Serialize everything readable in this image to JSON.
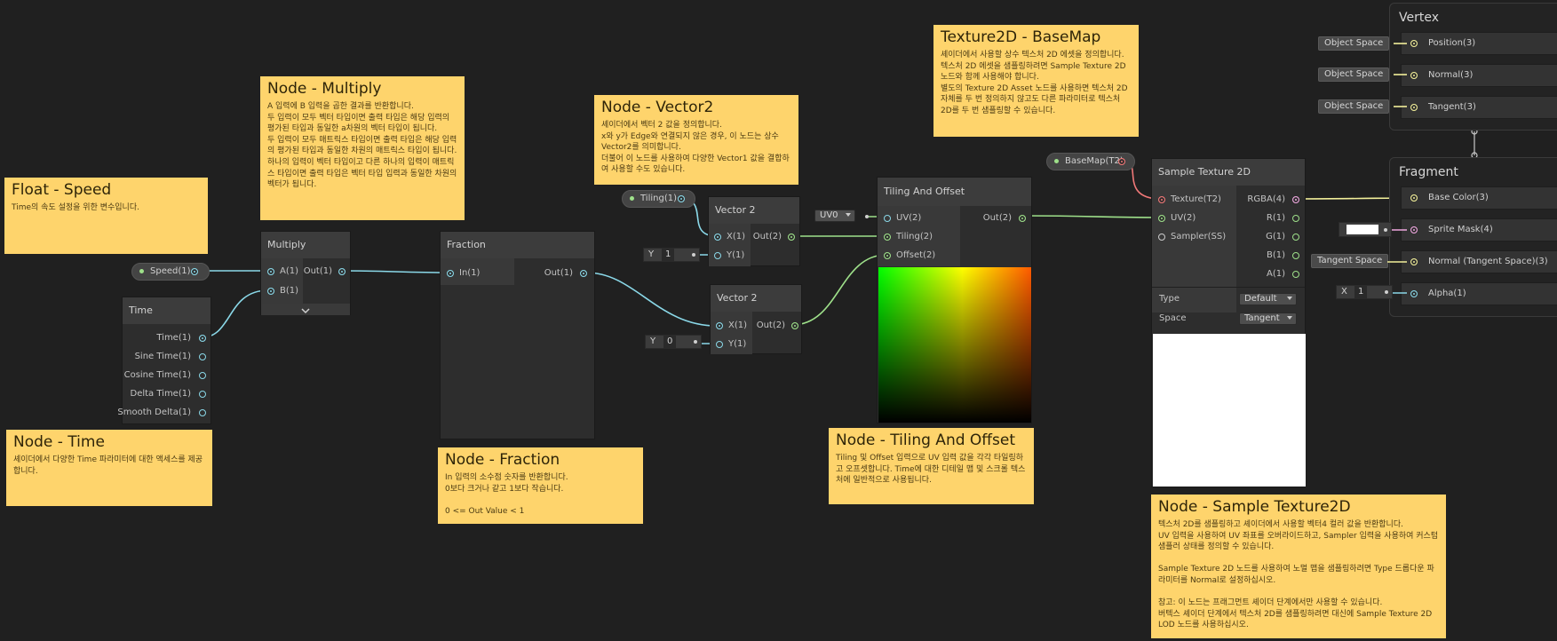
{
  "notes": {
    "float_speed": {
      "title": "Float - Speed",
      "body": "Time의 속도 설정을 위한 변수입니다."
    },
    "multiply": {
      "title": "Node - Multiply",
      "body": "A 입력에 B 입력을 곱한 결과를 반환합니다.\n두 입력이 모두 벡터 타입이면 출력 타입은 해당 입력의 평가된 타입과 동일한 a차원의 벡터 타입이 됩니다.\n두 입력이 모두 매트릭스 타입이면 출력 타입은 해당 입력의 평가된 타입과 동일한 차원의 매트릭스 타입이 됩니다.\n하나의 입력이 벡터 타입이고 다른 하나의 입력이 매트릭스 타입이면 출력 타입은 벡터 타입 입력과 동일한 차원의 벡터가 됩니다."
    },
    "time": {
      "title": "Node - Time",
      "body": "셰이더에서 다양한 Time 파라미터에 대한 액세스를 제공합니다."
    },
    "fraction": {
      "title": "Node - Fraction",
      "body": "In 입력의 소수점 숫자를 반환합니다.\n0보다 크거나 같고 1보다 작습니다.\n\n0 <= Out Value < 1"
    },
    "vector2": {
      "title": "Node - Vector2",
      "body": "셰이더에서 벡터 2 값을 정의합니다.\nx와 y가 Edge와 연결되지 않은 경우, 이 노드는 상수 Vector2를 의미합니다.\n더불어 이 노드를 사용하여 다양한 Vector1 값을 결합하여 사용할 수도 있습니다."
    },
    "texture2d": {
      "title": "Texture2D - BaseMap",
      "body": "셰이더에서 사용할 상수 텍스처 2D 에셋을 정의합니다.\n텍스처 2D 에셋을 샘플링하려면 Sample Texture 2D 노드와 함께 사용해야 합니다.\n별도의 Texture 2D Asset 노드를 사용하면 텍스처 2D 자체를 두 번 정의하지 않고도 다른 파라미터로 텍스처 2D를 두 번 샘플링할 수 있습니다."
    },
    "tiling": {
      "title": "Node - Tiling And Offset",
      "body": "Tiling 및 Offset 입력으로 UV 입력 값을 각각 타일링하고 오프셋합니다. Time에 대한 디테일 맵 및 스크롤 텍스처에 일반적으로 사용됩니다."
    },
    "sample": {
      "title": "Node - Sample Texture2D",
      "body": "텍스처 2D를 샘플링하고 셰이더에서 사용할 벡터4 컬러 값을 반환합니다.\nUV 입력을 사용하여 UV 좌표를 오버라이드하고, Sampler 입력을 사용하여 커스텀 샘플러 상태를 정의할 수 있습니다.\n\nSample Texture 2D 노드를 사용하여 노멀 맵을 샘플링하려면 Type 드롭다운 파라미터를 Normal로 설정하십시오.\n\n참고: 이 노드는 프래그먼트 셰이더 단계에서만 사용할 수 있습니다.\n버텍스 셰이더 단계에서 텍스처 2D를 샘플링하려면 대신에 Sample Texture 2D LOD 노드를 사용하십시오."
    }
  },
  "properties": {
    "speed": "Speed(1)",
    "tiling": "Tiling(1)",
    "basemap": "BaseMap(T2)"
  },
  "nodes": {
    "time": {
      "title": "Time",
      "outputs": [
        "Time(1)",
        "Sine Time(1)",
        "Cosine Time(1)",
        "Delta Time(1)",
        "Smooth Delta(1)"
      ]
    },
    "multiply": {
      "title": "Multiply",
      "inputs": [
        "A(1)",
        "B(1)"
      ],
      "output": "Out(1)"
    },
    "fraction": {
      "title": "Fraction",
      "input": "In(1)",
      "output": "Out(1)"
    },
    "vector2a": {
      "title": "Vector 2",
      "inputs": [
        "X(1)",
        "Y(1)"
      ],
      "output": "Out(2)",
      "y_label": "Y",
      "y_value": "1"
    },
    "vector2b": {
      "title": "Vector 2",
      "inputs": [
        "X(1)",
        "Y(1)"
      ],
      "output": "Out(2)",
      "y_label": "Y",
      "y_value": "0"
    },
    "tiling": {
      "title": "Tiling And Offset",
      "inputs": [
        "UV(2)",
        "Tiling(2)",
        "Offset(2)"
      ],
      "output": "Out(2)",
      "uv_option": "UV0"
    },
    "sample": {
      "title": "Sample Texture 2D",
      "inputs": [
        "Texture(T2)",
        "UV(2)",
        "Sampler(SS)"
      ],
      "outputs": [
        "RGBA(4)",
        "R(1)",
        "G(1)",
        "B(1)",
        "A(1)"
      ],
      "type_label": "Type",
      "type_value": "Default",
      "space_label": "Space",
      "space_value": "Tangent"
    }
  },
  "vertex": {
    "title": "Vertex",
    "blocks": [
      {
        "label": "Position(3)",
        "chip": "Object Space"
      },
      {
        "label": "Normal(3)",
        "chip": "Object Space"
      },
      {
        "label": "Tangent(3)",
        "chip": "Object Space"
      }
    ]
  },
  "fragment": {
    "title": "Fragment",
    "blocks": [
      {
        "label": "Base Color(3)"
      },
      {
        "label": "Sprite Mask(4)"
      },
      {
        "label": "Normal (Tangent Space)(3)",
        "chip": "Tangent Space"
      },
      {
        "label": "Alpha(1)",
        "field_label": "X",
        "field_value": "1"
      }
    ]
  },
  "colors": {
    "background": "#202020",
    "note": "#fed46c",
    "float_wire": "#8ad8e8",
    "vector2_wire": "#9ee08a",
    "texture_wire": "#f07878",
    "color_wire": "#f2ef9a"
  },
  "icons": [
    "collapse-chevron-icon",
    "dropdown-caret-icon",
    "port-icon"
  ]
}
